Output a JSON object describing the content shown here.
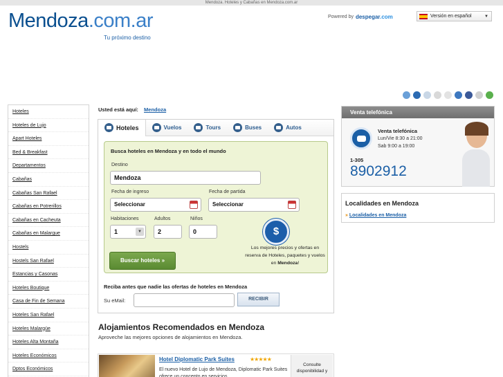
{
  "window": {
    "title": "Mendoza. Hoteles y Cabañas en Mendoza.com.ar"
  },
  "header": {
    "logo_main": "Mendoza",
    "logo_tld": ".com.ar",
    "tagline": "Tu próximo destino",
    "powered_by": "Powered by",
    "powered_brand": "despegar",
    "powered_brand_com": ".com",
    "language": "Versión en español",
    "language_options": [
      "Versión en español"
    ]
  },
  "social_icons": [
    "delicious-icon",
    "digg-icon",
    "reddit-icon",
    "stumbleupon-icon",
    "yahoo-icon",
    "technorati-icon",
    "facebook-icon",
    "google-icon",
    "twitter-icon"
  ],
  "sidebar": {
    "items": [
      {
        "label": "Hoteles"
      },
      {
        "label": "Hoteles de Lujo"
      },
      {
        "label": "Apart Hoteles"
      },
      {
        "label": "Bed & Breakfast"
      },
      {
        "label": "Departamentos"
      },
      {
        "label": "Cabañas"
      },
      {
        "label": "Cabañas San Rafael"
      },
      {
        "label": "Cabañas en Potrerillos"
      },
      {
        "label": "Cabañas en Cacheuta"
      },
      {
        "label": "Cabañas en Malargue"
      },
      {
        "label": "Hostels"
      },
      {
        "label": "Hostels San Rafael"
      },
      {
        "label": "Estancias y Casonas"
      },
      {
        "label": "Hoteles Boutique"
      },
      {
        "label": "Casa de Fin de Semana"
      },
      {
        "label": "Hoteles San Rafael"
      },
      {
        "label": "Hoteles Malargüe"
      },
      {
        "label": "Hoteles Alta Montaña"
      },
      {
        "label": "Hoteles Económicos"
      },
      {
        "label": "Dptos Económicos"
      }
    ]
  },
  "breadcrumb": {
    "prefix": "Usted está aquí:",
    "current": "Mendoza"
  },
  "search": {
    "tabs": [
      {
        "label": "Hoteles",
        "icon": "bed-icon"
      },
      {
        "label": "Vuelos",
        "icon": "plane-icon"
      },
      {
        "label": "Tours",
        "icon": "luggage-icon"
      },
      {
        "label": "Buses",
        "icon": "bus-icon"
      },
      {
        "label": "Autos",
        "icon": "car-icon"
      }
    ],
    "title": "Busca hoteles en Mendoza y en todo el mundo",
    "destino_label": "Destino",
    "destino_value": "Mendoza",
    "checkin_label": "Fecha de ingreso",
    "checkin_value": "Seleccionar",
    "checkout_label": "Fecha de partida",
    "checkout_value": "Seleccionar",
    "rooms_label": "Habitaciones",
    "rooms_value": "1",
    "adults_label": "Adultos",
    "adults_value": "2",
    "children_label": "Niños",
    "children_value": "0",
    "submit_label": "Buscar hoteles »",
    "promo_text": "Los mejores precios y ofertas en reserva de Hoteles, paquetes y vuelos en",
    "promo_bold": "Mendoza",
    "promo_end": "!"
  },
  "newsletter": {
    "title": "Reciba antes que nadie las ofertas de hoteles en Mendoza",
    "email_label": "Su eMail:",
    "email_value": "",
    "submit_label": "RECIBIR"
  },
  "recommended": {
    "title": "Alojamientos Recomendados en Mendoza",
    "subtitle": "Aproveche las mejores opciones de alojamientos en Mendoza.",
    "hotel": {
      "name": "Hotel Diplomatic Park Suites",
      "stars": "★★★★★",
      "rating": 5,
      "description": "El nuevo Hotel de Lujo de Mendoza, Diplomatic Park Suites ofrece un concepto en servicios...",
      "cta": "Consulte disponibilidad y"
    }
  },
  "phone_sales": {
    "header": "Venta telefónica",
    "title": "Venta telefónica",
    "hours1": "Lun/Vie 8:30 a 21:00",
    "hours2": "Sab 9:00 a 19:00",
    "prefix": "1-305",
    "number": "8902912"
  },
  "localidades": {
    "title": "Localidades en Mendoza",
    "link": "Localidades en Mendoza"
  },
  "colors": {
    "brand_blue": "#1b5fa6",
    "logo_blue": "#0a4f8f",
    "green_panel": "#eef4d6",
    "green_button": "#5a8a32"
  }
}
